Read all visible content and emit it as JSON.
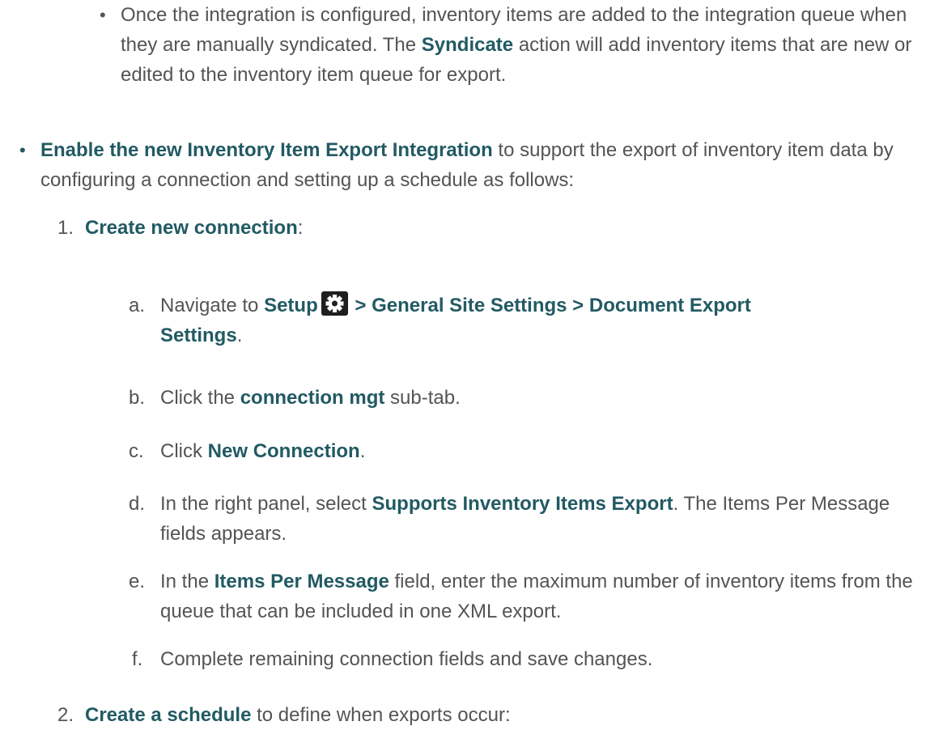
{
  "sub_bullet": {
    "pre": "Once the integration is configured, inventory items are added to the integration queue when they are manually syndicated. The ",
    "term": "Syndicate",
    "post": " action will add inventory items that are new or edited to the inventory item queue for export."
  },
  "main_bullet": {
    "term": "Enable the new Inventory Item Export Integration",
    "post": " to support the export of inventory item data by configuring a connection and setting up a schedule as follows:"
  },
  "steps": [
    {
      "marker": "1.",
      "term": "Create new connection",
      "post": ":",
      "substeps": [
        {
          "marker": "a.",
          "pre": "Navigate to ",
          "term1": "Setup",
          "icon": "gear-icon",
          "term2": " > General Site Settings > Document Export Settings",
          "post": "."
        },
        {
          "marker": "b.",
          "pre": "Click the ",
          "term": "connection mgt",
          "post": " sub-tab."
        },
        {
          "marker": "c.",
          "pre": "Click ",
          "term": "New Connection",
          "post": "."
        },
        {
          "marker": "d.",
          "pre": "In the right panel, select ",
          "term": "Supports Inventory Items Export",
          "post": ". The Items Per Message fields appears."
        },
        {
          "marker": "e.",
          "pre": "In the ",
          "term": "Items Per Message",
          "post": " field, enter the maximum number of inventory items from the queue that can be included in one XML export."
        },
        {
          "marker": "f.",
          "text": "Complete remaining connection fields and save changes."
        }
      ]
    },
    {
      "marker": "2.",
      "term": "Create a schedule",
      "post": " to define when exports occur:"
    }
  ],
  "colors": {
    "text": "#545454",
    "emphasis": "#225a63"
  }
}
